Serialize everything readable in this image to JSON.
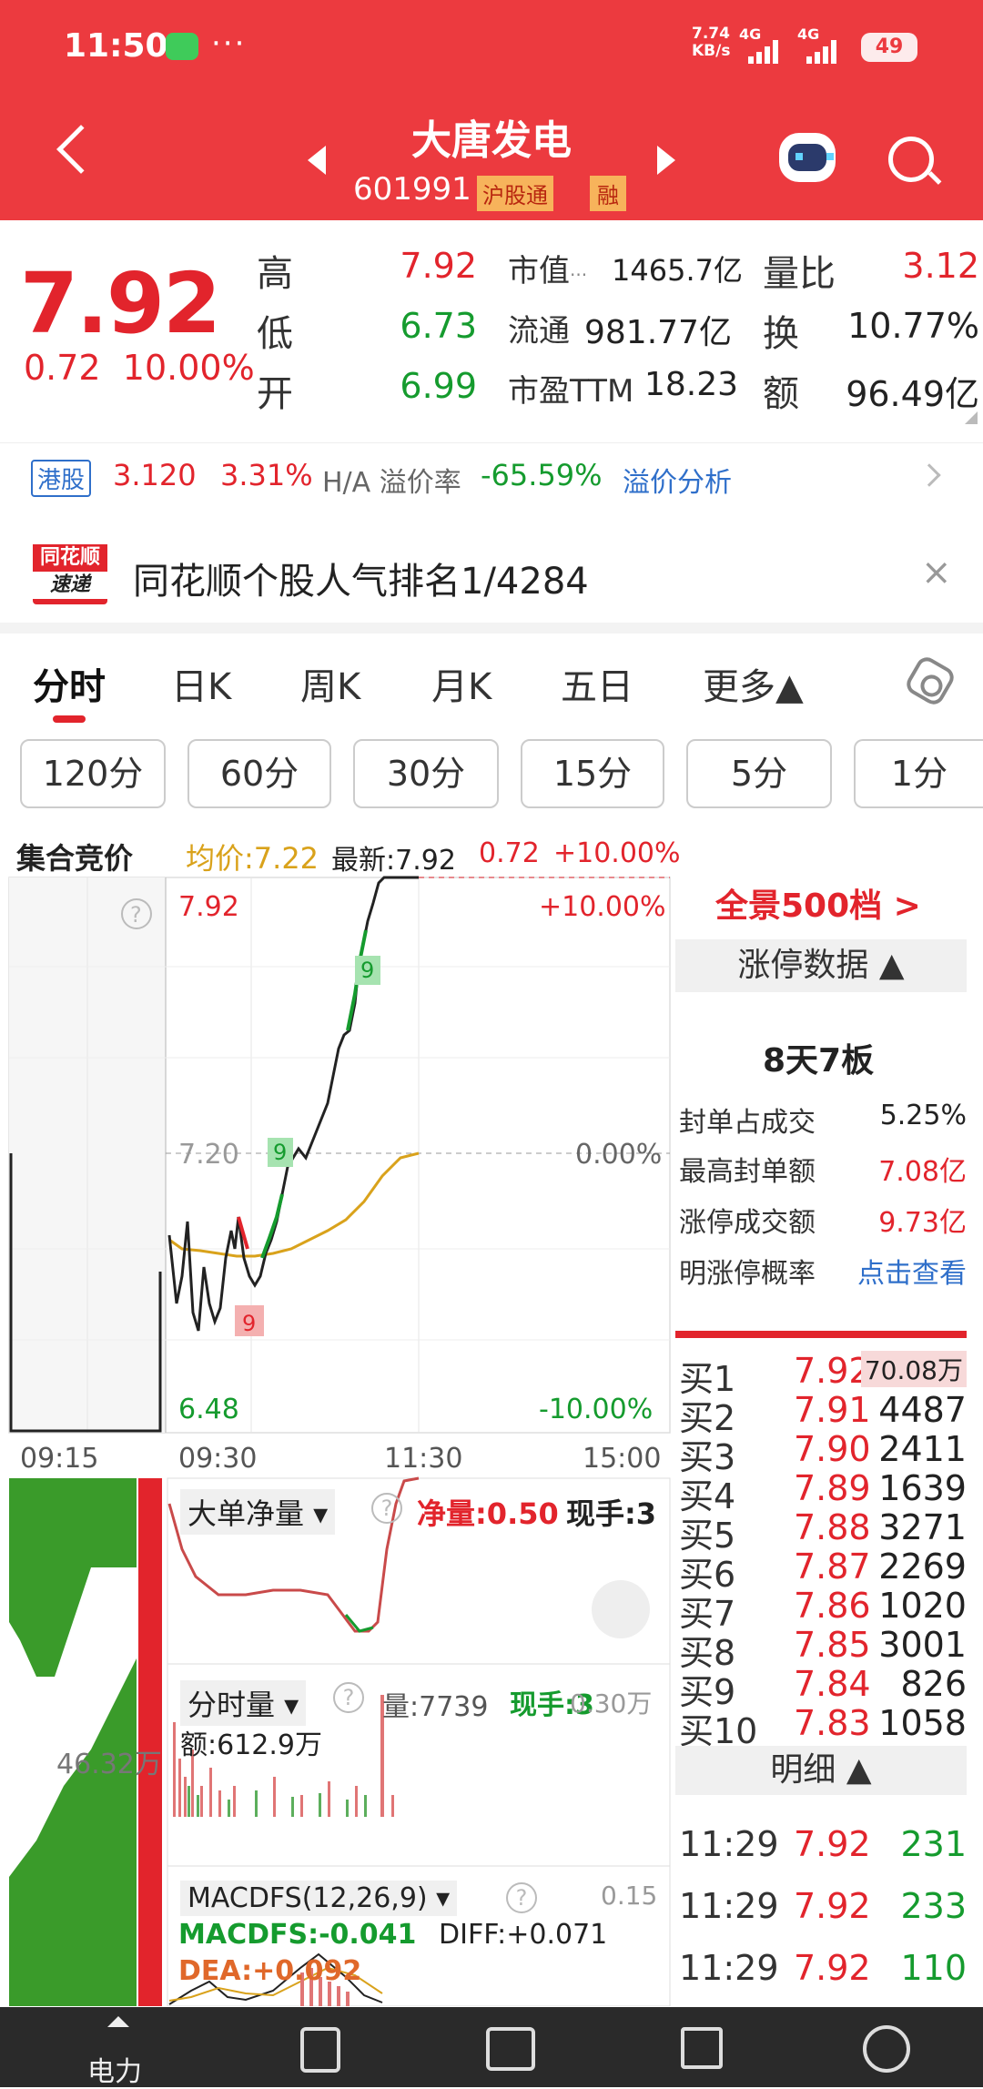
{
  "status": {
    "time": "11:50",
    "dots": "···",
    "net_speed": "7.74",
    "net_unit": "KB/s",
    "sig1": "4G",
    "sig2": "4G",
    "battery": "49"
  },
  "header": {
    "title": "大唐发电",
    "code": "601991",
    "tag1": "沪股通",
    "tag2": "融"
  },
  "quote": {
    "price": "7.92",
    "change": "0.72",
    "change_pct": "10.00%",
    "high_label": "高",
    "high": "7.92",
    "low_label": "低",
    "low": "6.73",
    "open_label": "开",
    "open": "6.99",
    "mcap_label": "市值",
    "mcap_icon": "···",
    "mcap": "1465.7亿",
    "float_label": "流通",
    "float": "981.77亿",
    "pe_label": "市盈TTM",
    "pe": "18.23",
    "vr_label": "量比",
    "vr": "3.12",
    "turnover_label": "换",
    "turnover": "10.77%",
    "amount_label": "额",
    "amount": "96.49亿"
  },
  "hk": {
    "badge": "港股",
    "price": "3.120",
    "pct": "3.31%",
    "premium_label": "H/A 溢价率",
    "premium": "-65.59%",
    "analysis": "溢价分析"
  },
  "news": {
    "logo_top": "同花顺",
    "logo_bottom": "速递",
    "text": "同花顺个股人气排名1/4284",
    "close": "×"
  },
  "tabs": [
    "分时",
    "日K",
    "周K",
    "月K",
    "五日",
    "更多▲"
  ],
  "periods": [
    "120分",
    "60分",
    "30分",
    "15分",
    "5分",
    "1分"
  ],
  "chart_header": {
    "auction": "集合竞价",
    "avg": "均价:7.22",
    "latest": "最新:7.92",
    "chg": "0.72",
    "pct": "+10.00%"
  },
  "chart": {
    "y_top": "7.92",
    "y_mid": "7.20",
    "y_bot": "6.48",
    "pct_top": "+10.00%",
    "pct_mid": "0.00%",
    "pct_bot": "-10.00%",
    "x_labels": [
      "09:15",
      "09:30",
      "11:30",
      "15:00"
    ],
    "help": "?",
    "flag": "9",
    "big_order_label": "大单净量 ▾",
    "net_label": "净量:0.50",
    "hand_label": "现手:3",
    "vol_label": "分时量 ▾",
    "vol_value": "量:7739",
    "vol_hand": "现手:3",
    "vol_right": "0.30万",
    "amt_label": "额:612.9万",
    "left_vol": "46.32万",
    "macd_label": "MACDFS(12,26,9) ▾",
    "macd_val": "0.15",
    "macd_line": "MACDFS:-0.041",
    "diff": "DIFF:+0.071",
    "dea": "DEA:+0.092"
  },
  "right_panel": {
    "panorama": "全景500档 >",
    "limit_header": "涨停数据 ▲",
    "streak": "8天7板",
    "rows": [
      {
        "k": "封单占成交",
        "v": "5.25%"
      },
      {
        "k": "最高封单额",
        "v": "7.08亿"
      },
      {
        "k": "涨停成交额",
        "v": "9.73亿"
      },
      {
        "k": "明涨停概率",
        "v": "点击查看"
      }
    ],
    "bids": [
      {
        "k": "买1",
        "p": "7.92",
        "q": "70.08万"
      },
      {
        "k": "买2",
        "p": "7.91",
        "q": "4487"
      },
      {
        "k": "买3",
        "p": "7.90",
        "q": "2411"
      },
      {
        "k": "买4",
        "p": "7.89",
        "q": "1639"
      },
      {
        "k": "买5",
        "p": "7.88",
        "q": "3271"
      },
      {
        "k": "买6",
        "p": "7.87",
        "q": "2269"
      },
      {
        "k": "买7",
        "p": "7.86",
        "q": "1020"
      },
      {
        "k": "买8",
        "p": "7.85",
        "q": "3001"
      },
      {
        "k": "买9",
        "p": "7.84",
        "q": "826"
      },
      {
        "k": "买10",
        "p": "7.83",
        "q": "1058"
      }
    ],
    "detail_header": "明细 ▲",
    "ticks": [
      {
        "t": "11:29",
        "p": "7.92",
        "q": "231"
      },
      {
        "t": "11:29",
        "p": "7.92",
        "q": "233"
      },
      {
        "t": "11:29",
        "p": "7.92",
        "q": "110"
      }
    ]
  },
  "nav": {
    "first_label": "电力"
  },
  "colors": {
    "header_red": "#ec3a3f",
    "up_red": "#e2242c",
    "down_green": "#159b2e",
    "avg_line": "#d9a21b",
    "link_blue": "#2f6fca"
  }
}
